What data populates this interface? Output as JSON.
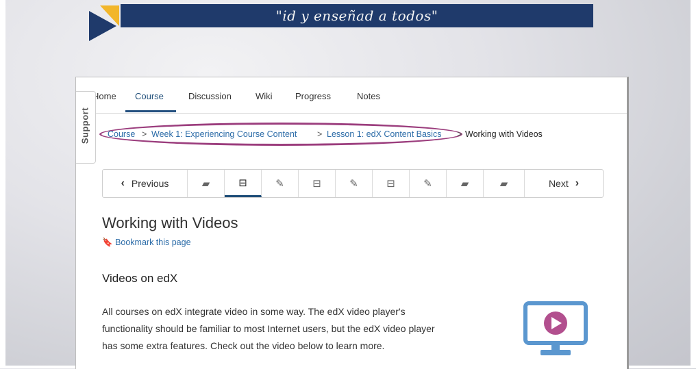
{
  "banner": {
    "slogan": "\"id y enseñad a todos\""
  },
  "topnav": {
    "items": [
      "Home",
      "Course",
      "Discussion",
      "Wiki",
      "Progress",
      "Notes"
    ]
  },
  "support": {
    "label": "Support"
  },
  "breadcrumb": {
    "items": [
      "Course",
      "Week 1: Experiencing Course Content",
      "Lesson 1: edX Content Basics"
    ],
    "current": "Working with Videos",
    "separator": ">"
  },
  "sequence": {
    "previous": "Previous",
    "next": "Next",
    "units": [
      "book-icon",
      "film-icon",
      "edit-icon",
      "film-icon",
      "edit-icon",
      "film-icon",
      "edit-icon",
      "book-icon",
      "book-icon"
    ],
    "active_index": 1
  },
  "page": {
    "title": "Working with Videos",
    "bookmark": "Bookmark this page",
    "section_title": "Videos on edX",
    "body_lines": [
      "All courses on edX integrate video in some way. The edX video player's",
      "functionality should be familiar to most Internet users, but the edX video player",
      "has some extra features. Check out the video below to learn more."
    ]
  },
  "colors": {
    "navy": "#1f3a6b",
    "gold": "#f2b62b",
    "highlight": "#9b3d7d",
    "link": "#2c6ca8",
    "monitor": "#5b97cf",
    "play": "#b24f8e"
  }
}
